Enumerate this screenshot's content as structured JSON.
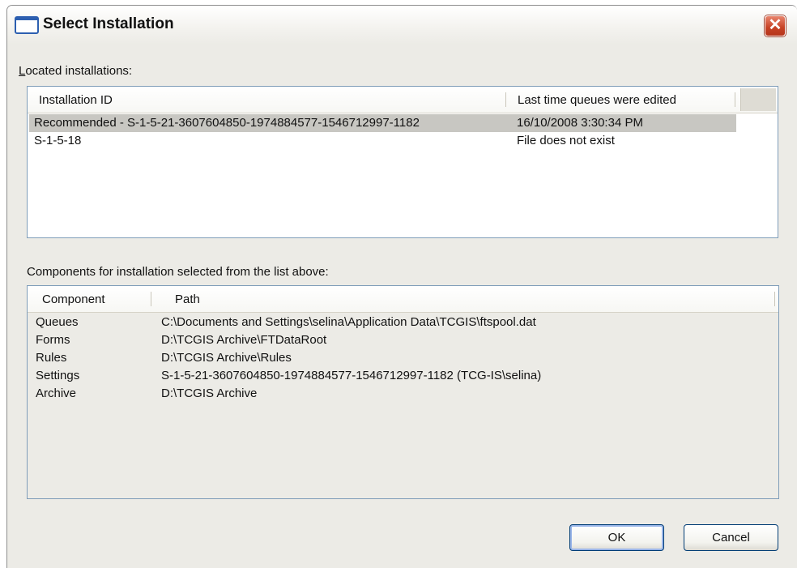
{
  "window": {
    "title": "Select Installation",
    "title_icon": "window-icon",
    "close_icon": "close-icon",
    "close_glyph": "✕"
  },
  "installations": {
    "label_prefix": "",
    "label_underlined": "L",
    "label_rest": "ocated installations:",
    "columns": [
      "Installation ID",
      "Last time queues were edited"
    ],
    "rows": [
      {
        "id": "Recommended -  S-1-5-21-3607604850-1974884577-1546712997-1182",
        "edited": "16/10/2008 3:30:34 PM",
        "selected": true
      },
      {
        "id": "S-1-5-18",
        "edited": "File does not exist",
        "selected": false
      }
    ]
  },
  "components": {
    "label": "Components for installation selected from the list above:",
    "columns": [
      "Component",
      "Path"
    ],
    "rows": [
      {
        "component": "Queues",
        "path": "C:\\Documents and Settings\\selina\\Application Data\\TCGIS\\ftspool.dat"
      },
      {
        "component": "Forms",
        "path": "D:\\TCGIS Archive\\FTDataRoot"
      },
      {
        "component": "Rules",
        "path": "D:\\TCGIS Archive\\Rules"
      },
      {
        "component": "Settings",
        "path": "S-1-5-21-3607604850-1974884577-1546712997-1182 (TCG-IS\\selina)"
      },
      {
        "component": "Archive",
        "path": "D:\\TCGIS Archive"
      }
    ]
  },
  "buttons": {
    "ok": "OK",
    "cancel": "Cancel"
  }
}
